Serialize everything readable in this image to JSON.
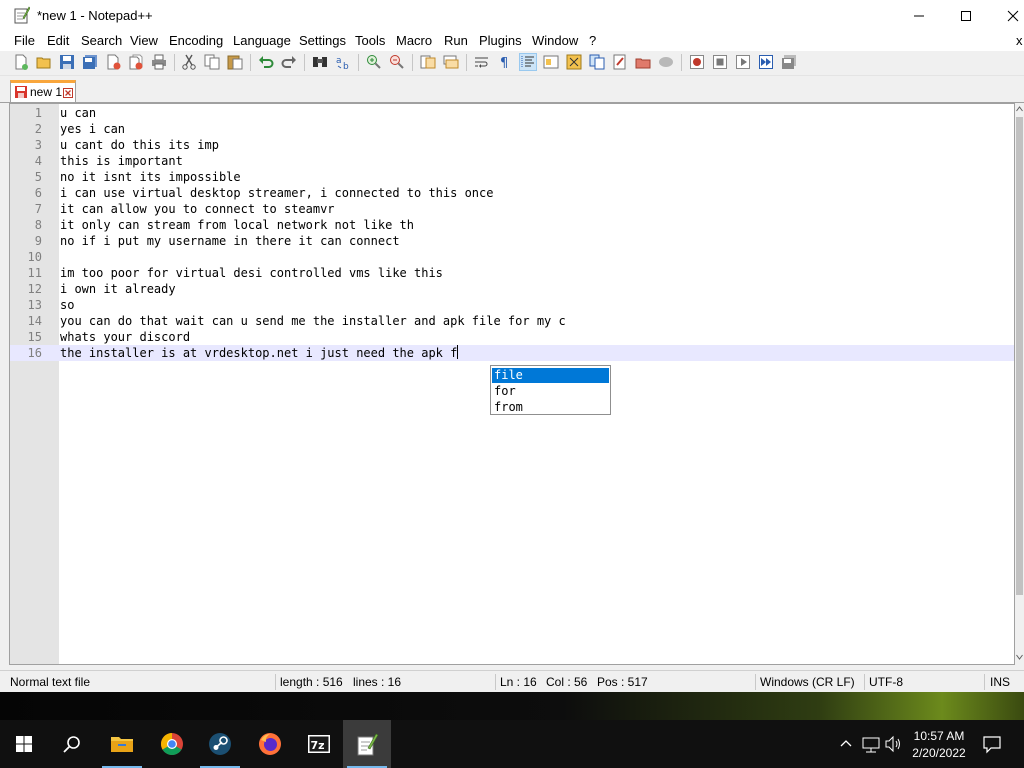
{
  "window": {
    "title": "*new 1 - Notepad++",
    "menu": [
      "File",
      "Edit",
      "Search",
      "View",
      "Encoding",
      "Language",
      "Settings",
      "Tools",
      "Macro",
      "Run",
      "Plugins",
      "Window",
      "?"
    ],
    "menu_close": "x"
  },
  "tab": {
    "label": "new 1"
  },
  "editor": {
    "lines": [
      "u can",
      "yes i can",
      "u cant do this its imp",
      "this is important",
      "no it isnt its impossible",
      "i can use virtual desktop streamer, i connected to this once",
      "it can allow you to connect to steamvr",
      "it only can stream from local network not like th",
      "no if i put my username in there it can connect",
      "",
      "im too poor for virtual desi controlled vms like this",
      "i own it already",
      "so",
      "you can do that wait can u send me the installer and apk file for my c",
      "whats your discord",
      "the installer is at vrdesktop.net i just need the apk f"
    ],
    "current_line": 16
  },
  "autocomplete": {
    "items": [
      "file",
      "for",
      "from"
    ],
    "selected": "file"
  },
  "status": {
    "file_type": "Normal text file",
    "length": "length : 516",
    "lines": "lines : 16",
    "ln": "Ln : 16",
    "col": "Col : 56",
    "pos": "Pos : 517",
    "eol": "Windows (CR LF)",
    "encoding": "UTF-8",
    "mode": "INS"
  },
  "taskbar": {
    "apps": [
      "start-icon",
      "search-icon",
      "file-explorer-icon",
      "chrome-icon",
      "steam-icon",
      "firefox-icon",
      "7zip-icon",
      "notepadpp-icon"
    ],
    "time": "10:57 AM",
    "date": "2/20/2022"
  },
  "colors": {
    "selection": "#0078d7",
    "current_line": "#e8e8ff",
    "tab_accent": "#f9a63c",
    "gutter": "#e4e4e4"
  }
}
